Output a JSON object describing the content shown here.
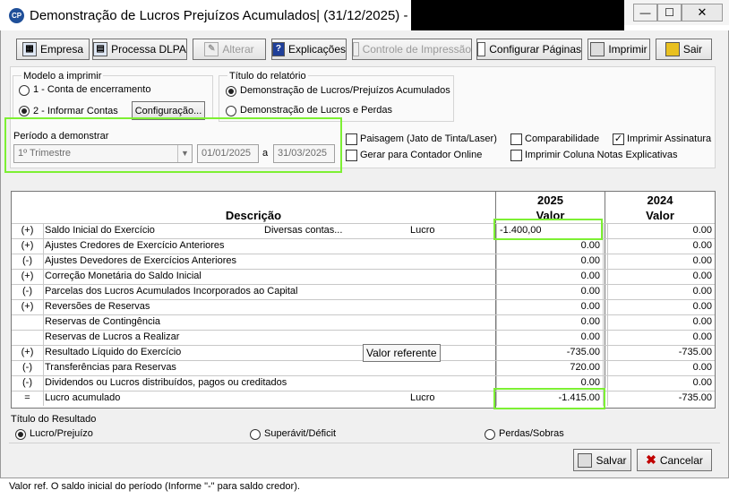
{
  "window": {
    "title": "Demonstração de Lucros Prejuízos Acumulados| (31/12/2025) -",
    "app_icon_text": "CP",
    "minimize": "—",
    "maximize": "☐",
    "close": "✕"
  },
  "toolbar": {
    "empresa": "Empresa",
    "processa": "Processa DLPA",
    "alterar": "Alterar",
    "explicacoes": "Explicações",
    "controle": "Controle de Impressão",
    "configurar": "Configurar Páginas",
    "imprimir": "Imprimir",
    "sair": "Sair"
  },
  "modelo": {
    "title": "Modelo a imprimir",
    "opt1": "1 - Conta de encerramento",
    "opt2": "2 - Informar Contas",
    "config_button": "Configuração..."
  },
  "titulo_relatorio": {
    "title": "Título do relatório",
    "opt1": "Demonstração de Lucros/Prejuízos Acumulados",
    "opt2": "Demonstração de Lucros e Perdas"
  },
  "periodo": {
    "label": "Período a demonstrar",
    "select_value": "1º Trimestre",
    "date_from": "01/01/2025",
    "sep": "a",
    "date_to": "31/03/2025"
  },
  "options": {
    "paisagem": "Paisagem (Jato de Tinta/Laser)",
    "contador": "Gerar para Contador Online",
    "comparabilidade": "Comparabilidade",
    "imprimir_assinatura": "Imprimir Assinatura",
    "notas": "Imprimir Coluna Notas Explicativas",
    "check": "✓"
  },
  "table": {
    "desc_header": "Descrição",
    "year1": "2025",
    "year2": "2024",
    "valor": "Valor",
    "rows": [
      {
        "sign": "(+)",
        "desc": "Saldo Inicial do Exercício",
        "extra": "Diversas contas...",
        "type": "Lucro",
        "v1": "-1.400,00",
        "v2": "0.00"
      },
      {
        "sign": "(+)",
        "desc": "Ajustes Credores de Exercício Anteriores",
        "extra": "",
        "type": "",
        "v1": "0.00",
        "v2": "0.00"
      },
      {
        "sign": "(-)",
        "desc": "Ajustes Devedores de Exercícios Anteriores",
        "extra": "",
        "type": "",
        "v1": "0.00",
        "v2": "0.00"
      },
      {
        "sign": "(+)",
        "desc": "Correção Monetária do Saldo Inicial",
        "extra": "",
        "type": "",
        "v1": "0.00",
        "v2": "0.00"
      },
      {
        "sign": "(-)",
        "desc": "Parcelas dos Lucros Acumulados Incorporados ao Capital",
        "extra": "",
        "type": "",
        "v1": "0.00",
        "v2": "0.00"
      },
      {
        "sign": "(+)",
        "desc": "Reversões de Reservas",
        "extra": "",
        "type": "",
        "v1": "0.00",
        "v2": "0.00"
      },
      {
        "sign": "",
        "desc": "Reservas de Contingência",
        "extra": "",
        "type": "",
        "v1": "0.00",
        "v2": "0.00"
      },
      {
        "sign": "",
        "desc": "Reservas de Lucros a Realizar",
        "extra": "",
        "type": "",
        "v1": "0.00",
        "v2": "0.00"
      },
      {
        "sign": "(+)",
        "desc": "Resultado Líquido do Exercício",
        "extra": "",
        "type": "",
        "v1": "-735.00",
        "v2": "-735.00"
      },
      {
        "sign": "(-)",
        "desc": "Transferências para Reservas",
        "extra": "",
        "type": "",
        "v1": "720.00",
        "v2": "0.00"
      },
      {
        "sign": "(-)",
        "desc": "Dividendos ou Lucros distribuídos, pagos ou creditados",
        "extra": "",
        "type": "",
        "v1": "0.00",
        "v2": "0.00"
      },
      {
        "sign": "=",
        "desc": "Lucro acumulado",
        "extra": "",
        "type": "Lucro",
        "v1": "-1.415.00",
        "v2": "-735.00"
      }
    ]
  },
  "tooltip": "Valor referente",
  "resultado": {
    "title": "Título do Resultado",
    "opt1": "Lucro/Prejuízo",
    "opt2": "Superávit/Déficit",
    "opt3": "Perdas/Sobras"
  },
  "actions": {
    "salvar": "Salvar",
    "cancelar": "Cancelar"
  },
  "status": "Valor ref. O saldo inicial do período (Informe \"-\" para saldo credor)."
}
